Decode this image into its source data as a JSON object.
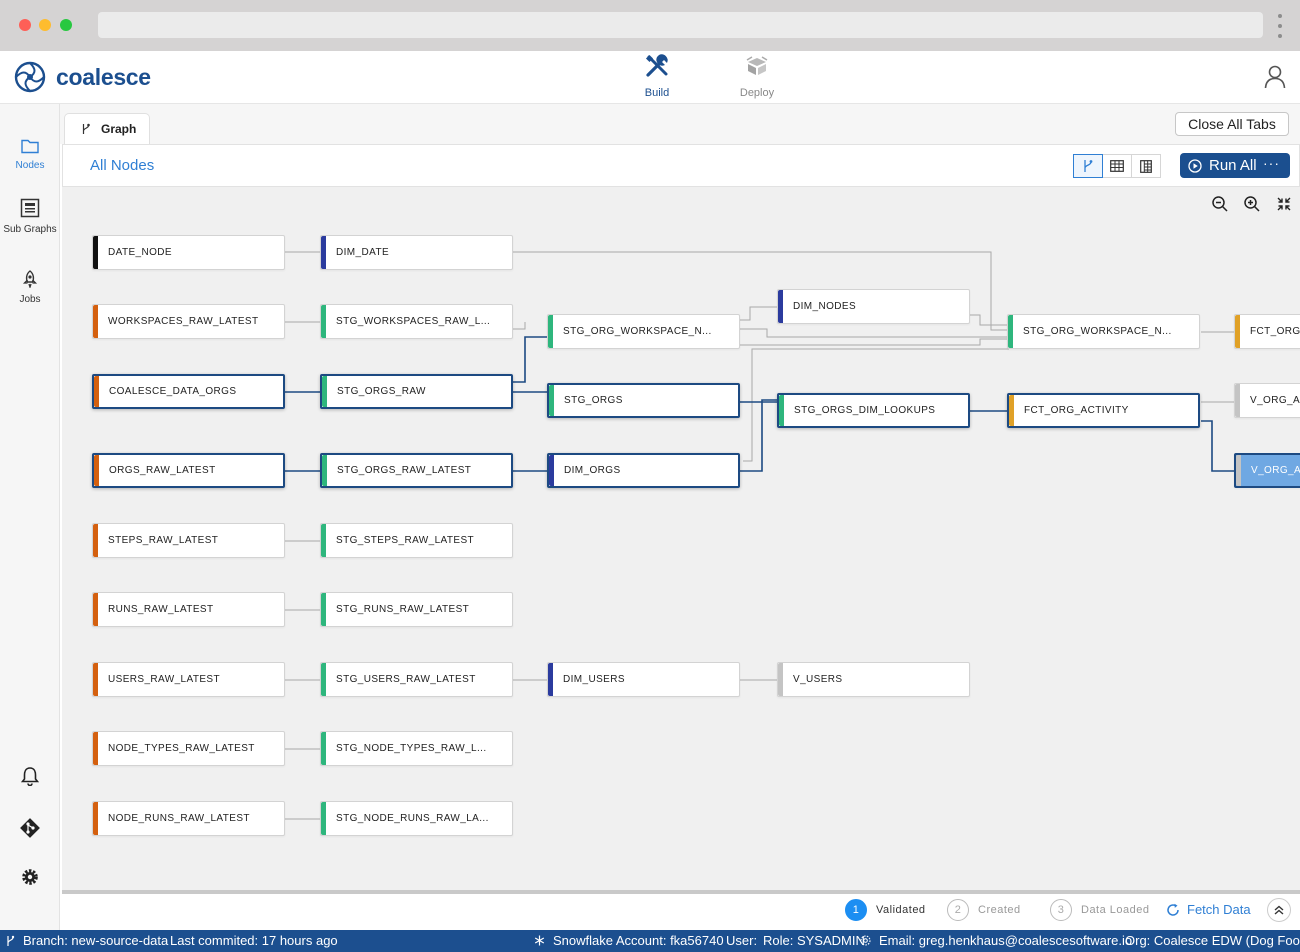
{
  "app": {
    "brand": "coalesce",
    "nav": [
      {
        "label": "Build",
        "icon": "build-tools-icon",
        "active": true
      },
      {
        "label": "Deploy",
        "icon": "deploy-box-icon",
        "active": false
      }
    ]
  },
  "sidebar": {
    "items": [
      {
        "label": "Nodes",
        "icon": "folder-icon",
        "active": true
      },
      {
        "label": "Sub Graphs",
        "icon": "subgraph-icon",
        "active": false
      },
      {
        "label": "Jobs",
        "icon": "rocket-icon",
        "active": false
      }
    ],
    "bottom_icons": [
      "bell-icon",
      "git-icon",
      "gear-icon"
    ]
  },
  "tabs": {
    "items": [
      {
        "label": "Graph",
        "icon": "branch-icon"
      }
    ],
    "close_all_label": "Close All Tabs"
  },
  "toolbar": {
    "view_title": "All Nodes",
    "view_modes": [
      "graph-view-icon",
      "table-view-icon",
      "column-view-icon"
    ],
    "run_label": "Run All",
    "run_more": "···"
  },
  "graph": {
    "zoom_controls": [
      "zoom-out-icon",
      "zoom-in-icon",
      "fit-screen-icon"
    ],
    "colors": {
      "source": "#d4600f",
      "stage": "#2eb67d",
      "dimension": "#2b3b9e",
      "fact": "#e0a127",
      "view": "#c4c4c4",
      "date": "#111111",
      "highlight": "#1d4a82",
      "selected": "#6fa8e3"
    },
    "nodes": [
      {
        "id": "n1",
        "label": "DATE_NODE",
        "type": "date"
      },
      {
        "id": "n2",
        "label": "DIM_DATE",
        "type": "dimension"
      },
      {
        "id": "n3",
        "label": "WORKSPACES_RAW_LATEST",
        "type": "source"
      },
      {
        "id": "n4",
        "label": "STG_WORKSPACES_RAW_L...",
        "type": "stage"
      },
      {
        "id": "n5",
        "label": "STG_ORG_WORKSPACE_N...",
        "type": "stage"
      },
      {
        "id": "n6",
        "label": "DIM_NODES",
        "type": "dimension"
      },
      {
        "id": "n7",
        "label": "STG_ORG_WORKSPACE_N...",
        "type": "stage"
      },
      {
        "id": "n8",
        "label": "FCT_ORG_",
        "type": "fact"
      },
      {
        "id": "n9",
        "label": "COALESCE_DATA_ORGS",
        "type": "source",
        "state": "highlighted"
      },
      {
        "id": "n10",
        "label": "STG_ORGS_RAW",
        "type": "stage",
        "state": "highlighted"
      },
      {
        "id": "n11",
        "label": "STG_ORGS",
        "type": "stage",
        "state": "highlighted"
      },
      {
        "id": "n12",
        "label": "STG_ORGS_DIM_LOOKUPS",
        "type": "stage",
        "state": "highlighted"
      },
      {
        "id": "n13",
        "label": "FCT_ORG_ACTIVITY",
        "type": "fact",
        "state": "highlighted"
      },
      {
        "id": "n14",
        "label": "V_ORG_AC",
        "type": "view"
      },
      {
        "id": "n15",
        "label": "ORGS_RAW_LATEST",
        "type": "source",
        "state": "highlighted"
      },
      {
        "id": "n16",
        "label": "STG_ORGS_RAW_LATEST",
        "type": "stage",
        "state": "highlighted"
      },
      {
        "id": "n17",
        "label": "DIM_ORGS",
        "type": "dimension",
        "state": "highlighted"
      },
      {
        "id": "n18",
        "label": "V_ORG_AC",
        "type": "view",
        "state": "selected"
      },
      {
        "id": "n19",
        "label": "STEPS_RAW_LATEST",
        "type": "source"
      },
      {
        "id": "n20",
        "label": "STG_STEPS_RAW_LATEST",
        "type": "stage"
      },
      {
        "id": "n21",
        "label": "RUNS_RAW_LATEST",
        "type": "source"
      },
      {
        "id": "n22",
        "label": "STG_RUNS_RAW_LATEST",
        "type": "stage"
      },
      {
        "id": "n23",
        "label": "USERS_RAW_LATEST",
        "type": "source"
      },
      {
        "id": "n24",
        "label": "STG_USERS_RAW_LATEST",
        "type": "stage"
      },
      {
        "id": "n25",
        "label": "DIM_USERS",
        "type": "dimension"
      },
      {
        "id": "n26",
        "label": "V_USERS",
        "type": "view"
      },
      {
        "id": "n27",
        "label": "NODE_TYPES_RAW_LATEST",
        "type": "source"
      },
      {
        "id": "n28",
        "label": "STG_NODE_TYPES_RAW_L...",
        "type": "stage"
      },
      {
        "id": "n29",
        "label": "NODE_RUNS_RAW_LATEST",
        "type": "source"
      },
      {
        "id": "n30",
        "label": "STG_NODE_RUNS_RAW_LA...",
        "type": "stage"
      }
    ]
  },
  "status": {
    "steps": [
      {
        "num": "1",
        "label": "Validated",
        "done": true
      },
      {
        "num": "2",
        "label": "Created",
        "done": false
      },
      {
        "num": "3",
        "label": "Data Loaded",
        "done": false
      }
    ],
    "fetch_label": "Fetch Data"
  },
  "footer": {
    "branch": "Branch: new-source-data",
    "last_commit": "Last commited: 17 hours ago",
    "account": "Snowflake Account: fka56740",
    "user": "User:",
    "role": "Role: SYSADMIN",
    "email": "Email: greg.henkhaus@coalescesoftware.io",
    "org": "Org: Coalesce EDW (Dog Food)"
  }
}
